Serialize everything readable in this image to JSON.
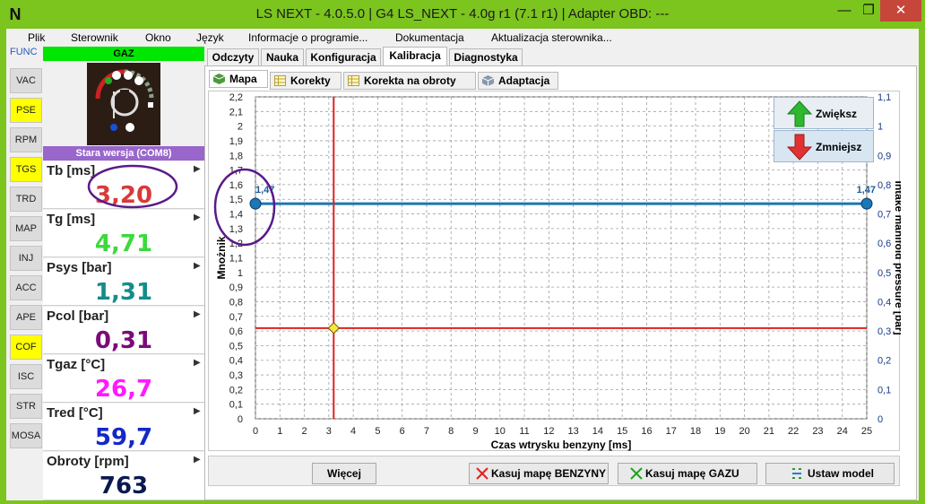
{
  "window": {
    "logo": "N",
    "title": "LS NEXT - 4.0.5.0  |  G4 LS_NEXT - 4.0g r1 (7.1 r1)  |  Adapter OBD: ---",
    "min_icon": "minimize-icon",
    "max_icon": "maximize-icon",
    "close_icon": "close-icon",
    "min_glyph": "—",
    "max_glyph": "❐",
    "close_glyph": "✕"
  },
  "menu": [
    "Plik",
    "Sterownik",
    "Okno",
    "Język",
    "Informacje o programie...",
    "Dokumentacja",
    "Aktualizacja sterownika..."
  ],
  "strip": {
    "func": "FUNC",
    "buttons": [
      {
        "label": "VAC",
        "active": false
      },
      {
        "label": "PSE",
        "active": true
      },
      {
        "label": "RPM",
        "active": false
      },
      {
        "label": "TGS",
        "active": true
      },
      {
        "label": "TRD",
        "active": false
      },
      {
        "label": "MAP",
        "active": false
      },
      {
        "label": "INJ",
        "active": false
      },
      {
        "label": "ACC",
        "active": false
      },
      {
        "label": "APE",
        "active": false
      },
      {
        "label": "COF",
        "active": true
      },
      {
        "label": "ISC",
        "active": false
      },
      {
        "label": "STR",
        "active": false
      },
      {
        "label": "MOSA",
        "active": false
      }
    ]
  },
  "status": {
    "fuel": "GAZ",
    "version": "Stara wersja (COM8)",
    "colors": {
      "gas": "#00e600",
      "version": "#9966cc"
    }
  },
  "gauges": [
    {
      "label": "Tb [ms]",
      "value": "3,20",
      "color": "#d93a3a"
    },
    {
      "label": "Tg [ms]",
      "value": "4,71",
      "color": "#3cd93c"
    },
    {
      "label": "Psys [bar]",
      "value": "1,31",
      "color": "#158c8c"
    },
    {
      "label": "Pcol [bar]",
      "value": "0,31",
      "color": "#7a0a7a"
    },
    {
      "label": "Tgaz [°C]",
      "value": "26,7",
      "color": "#ff1aff"
    },
    {
      "label": "Tred [°C]",
      "value": "59,7",
      "color": "#1428c8"
    },
    {
      "label": "Obroty [rpm]",
      "value": "763",
      "color": "#0a1a50"
    }
  ],
  "tabs": [
    {
      "label": "Odczyty",
      "active": false
    },
    {
      "label": "Nauka",
      "active": false
    },
    {
      "label": "Konfiguracja",
      "active": false
    },
    {
      "label": "Kalibracja",
      "active": true
    },
    {
      "label": "Diagnostyka",
      "active": false
    }
  ],
  "subtabs": [
    {
      "label": "Mapa",
      "icon": "map-cube-icon",
      "active": true
    },
    {
      "label": "Korekty",
      "icon": "grid-icon",
      "active": false
    },
    {
      "label": "Korekta na obroty",
      "icon": "grid-icon",
      "active": false
    },
    {
      "label": "Adaptacja",
      "icon": "cube-icon",
      "active": false
    }
  ],
  "side_buttons": {
    "increase": {
      "label": "Zwiększ",
      "icon": "arrow-up-icon",
      "color": "#2db82d"
    },
    "decrease": {
      "label": "Zmniejsz",
      "icon": "arrow-down-icon",
      "color": "#e03232"
    }
  },
  "bottom_buttons": {
    "more": {
      "label": "Więcej"
    },
    "clear_petrol": {
      "label": "Kasuj mapę BENZYNY",
      "icon": "x-red-icon"
    },
    "clear_gas": {
      "label": "Kasuj mapę GAZU",
      "icon": "x-green-icon"
    },
    "set_model": {
      "label": "Ustaw model",
      "icon": "model-icon"
    }
  },
  "chart_data": {
    "type": "line",
    "xlabel": "Czas wtrysku benzyny [ms]",
    "ylabel": "Mnożnik",
    "y2label": "Intake manifold pressure [bar]",
    "xlim": [
      0,
      25
    ],
    "ylim": [
      0,
      2.2
    ],
    "y2lim": [
      0,
      1.1
    ],
    "x_ticks": [
      0,
      1,
      2,
      3,
      4,
      5,
      6,
      7,
      8,
      9,
      10,
      11,
      12,
      13,
      14,
      15,
      16,
      17,
      18,
      19,
      20,
      21,
      22,
      23,
      24,
      25
    ],
    "y_ticks": [
      0,
      0.1,
      0.2,
      0.3,
      0.4,
      0.5,
      0.6,
      0.7,
      0.8,
      0.9,
      1,
      1.1,
      1.2,
      1.3,
      1.4,
      1.5,
      1.6,
      1.7,
      1.8,
      1.9,
      2,
      2.1,
      2.2
    ],
    "y_tick_labels": [
      "0",
      "0,1",
      "0,2",
      "0,3",
      "0,4",
      "0,5",
      "0,6",
      "0,7",
      "0,8",
      "0,9",
      "1",
      "1,1",
      "1,2",
      "1,3",
      "1,4",
      "1,5",
      "1,6",
      "1,7",
      "1,8",
      "1,9",
      "2",
      "2,1",
      "2,2"
    ],
    "y2_ticks": [
      0,
      0.1,
      0.2,
      0.3,
      0.4,
      0.5,
      0.6,
      0.7,
      0.8,
      0.9,
      1,
      1.1
    ],
    "y2_tick_labels": [
      "0",
      "0,1",
      "0,2",
      "0,3",
      "0,4",
      "0,5",
      "0,6",
      "0,7",
      "0,8",
      "0,9",
      "1",
      "1,1"
    ],
    "grid": true,
    "series": [
      {
        "x": [
          0,
          25
        ],
        "y": [
          1.47,
          1.47
        ],
        "point_labels": [
          "1,47",
          "1,47"
        ],
        "color": "#1a78b4"
      }
    ],
    "cursor": {
      "x": 3.2,
      "y": 0.62,
      "line_color": "#e02020",
      "marker_color": "#f5e642"
    }
  }
}
